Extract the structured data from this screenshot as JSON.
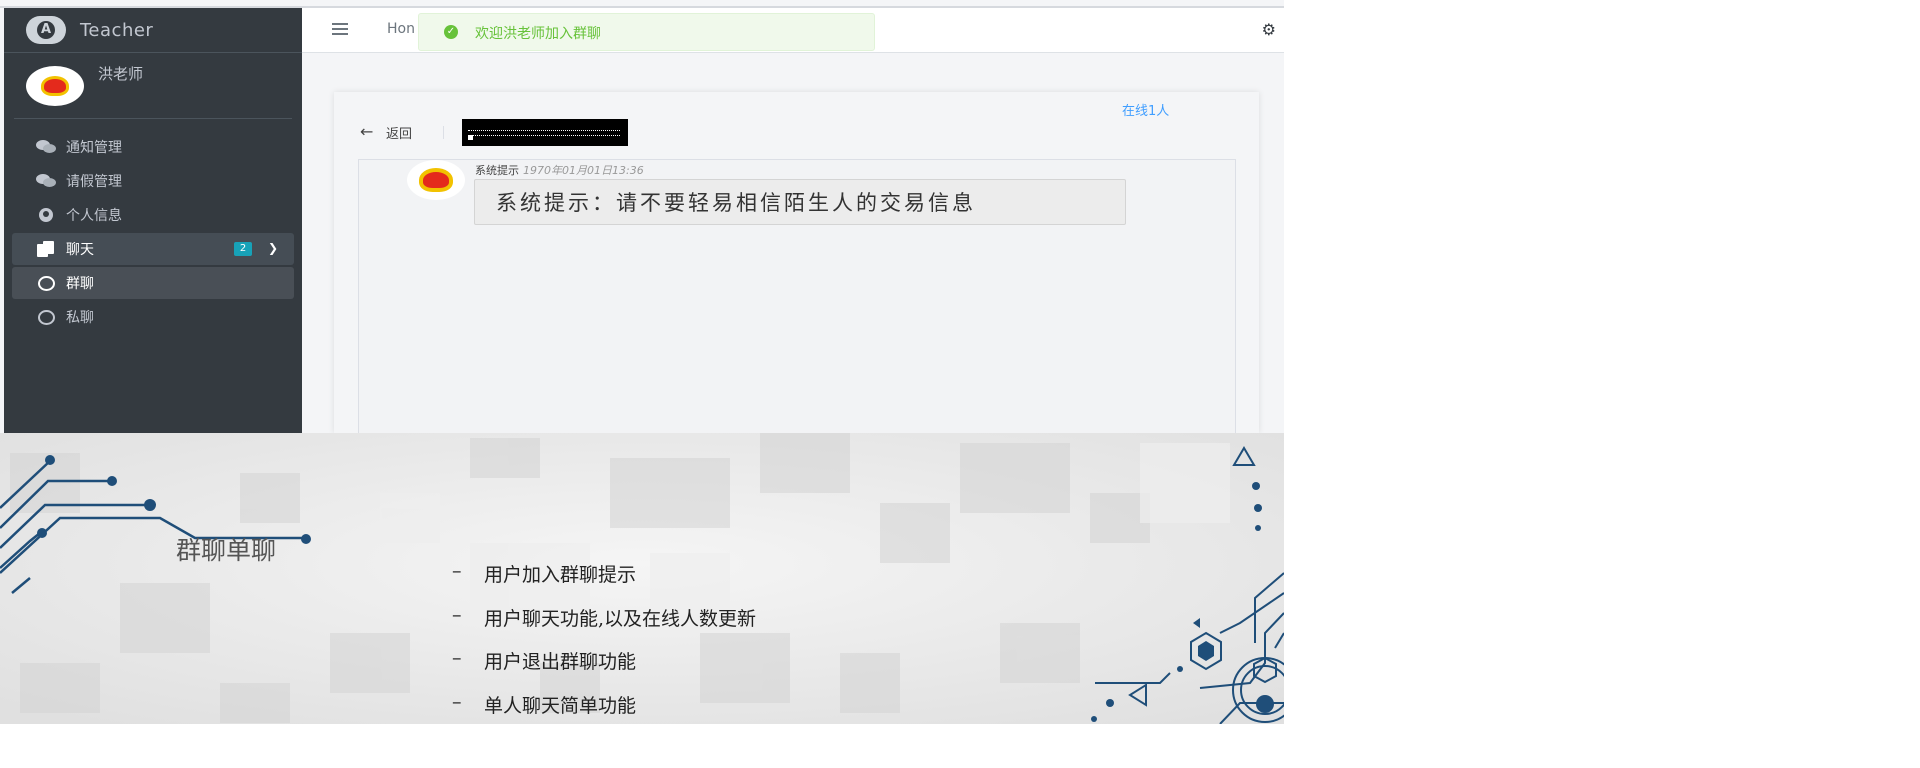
{
  "app": {
    "brand": "Teacher",
    "user_name": "洪老师",
    "nav": [
      {
        "label": "通知管理",
        "icon": "comments-icon"
      },
      {
        "label": "请假管理",
        "icon": "comments-icon"
      },
      {
        "label": "个人信息",
        "icon": "user-circle-icon"
      },
      {
        "label": "聊天",
        "icon": "copy-icon",
        "badge": "2",
        "expanded": true
      },
      {
        "label": "群聊",
        "icon": "circle-icon",
        "active": true
      },
      {
        "label": "私聊",
        "icon": "circle-icon"
      }
    ],
    "navbar": {
      "breadcrumb": "Hon",
      "toast": "欢迎洪老师加入群聊"
    },
    "chat": {
      "back_label": "返回",
      "online": "在线1人",
      "message": {
        "sender": "系统提示",
        "time": "1970年01月01日13:36",
        "text": "系统提示：请不要轻易相信陌生人的交易信息"
      }
    }
  },
  "slide": {
    "title": "群聊单聊",
    "bullet_marker": "–",
    "bullets": [
      "用户加入群聊提示",
      "用户聊天功能,以及在线人数更新",
      "用户退出群聊功能",
      "单人聊天简单功能"
    ]
  },
  "colors": {
    "sidebar": "#343a40",
    "toast_text": "#67c23a",
    "link": "#409eff",
    "badge": "#17a2b8",
    "circuit": "#1f4e79"
  }
}
